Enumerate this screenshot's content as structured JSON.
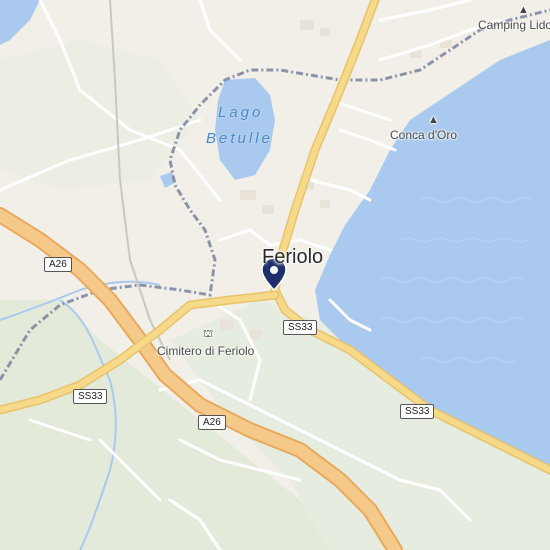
{
  "map": {
    "places": {
      "town": "Feriolo",
      "lake": [
        "Lago",
        "Betulle"
      ],
      "camping": "Camping Lido",
      "conca": "Conca d'Oro",
      "cemetery": "Cimitero di Feriolo"
    },
    "roads": {
      "a26_north": "A26",
      "a26_south": "A26",
      "ss33_center": "SS33",
      "ss33_west": "SS33",
      "ss33_east": "SS33"
    },
    "icons": {
      "camping": "campsite-icon",
      "conca": "campsite-icon",
      "cemetery": "cemetery-icon",
      "pin": "location-pin-icon"
    },
    "colors": {
      "water": "#a9c9ee",
      "land": "#f2efe9",
      "green": "#e2eadb",
      "motorway": "#f5c98a",
      "main_road": "#f7d98a",
      "boundary": "#8a93a8",
      "pin": "#1f2f6b"
    }
  }
}
